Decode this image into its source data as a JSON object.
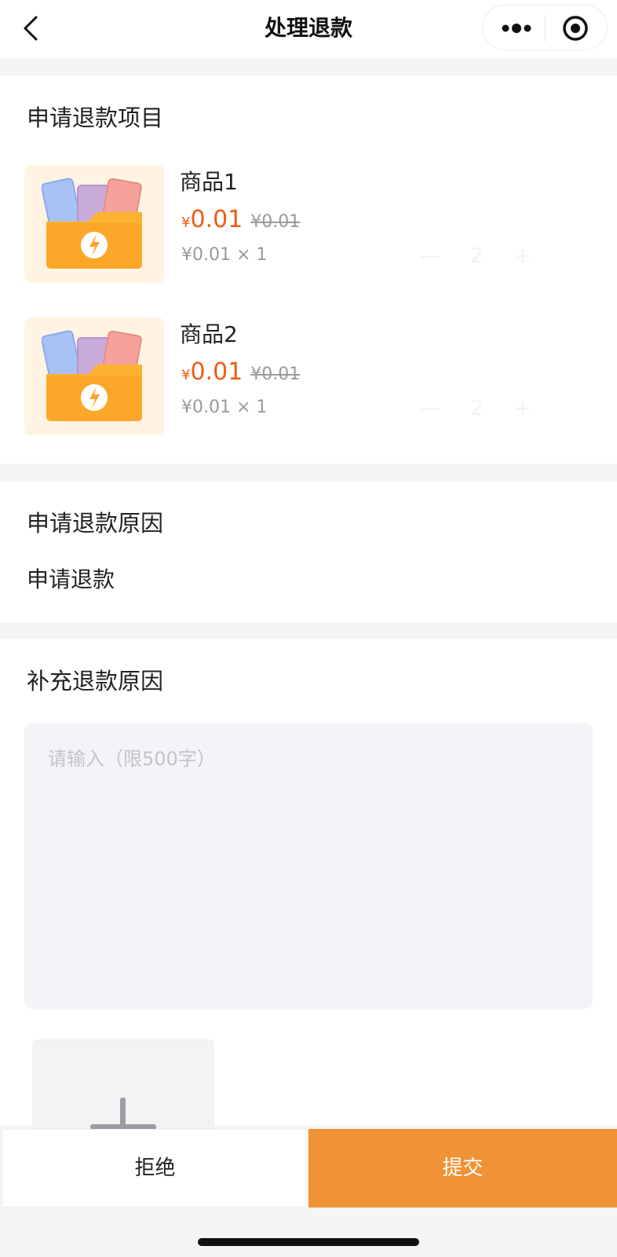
{
  "navbar": {
    "title": "处理退款",
    "back_icon": "chevron-left-icon",
    "more_icon": "more-dots-icon",
    "close_icon": "target-circle-icon"
  },
  "items_section": {
    "title": "申请退款项目",
    "items": [
      {
        "name": "商品1",
        "currency": "¥",
        "price": "0.01",
        "original_price": "¥0.01",
        "unit_price_line": "¥0.01 × 1",
        "stepper": {
          "minus": "—",
          "value": "2",
          "plus": "+"
        }
      },
      {
        "name": "商品2",
        "currency": "¥",
        "price": "0.01",
        "original_price": "¥0.01",
        "unit_price_line": "¥0.01 × 1",
        "stepper": {
          "minus": "—",
          "value": "2",
          "plus": "+"
        }
      }
    ]
  },
  "reason_section": {
    "title": "申请退款原因",
    "value": "申请退款"
  },
  "extra_section": {
    "title": "补充退款原因",
    "placeholder": "请输入（限500字）",
    "upload_icon": "plus-icon"
  },
  "actions": {
    "reject_label": "拒绝",
    "submit_label": "提交"
  },
  "colors": {
    "accent": "#f09336",
    "price": "#f05a13",
    "background": "#f5f5f5"
  }
}
